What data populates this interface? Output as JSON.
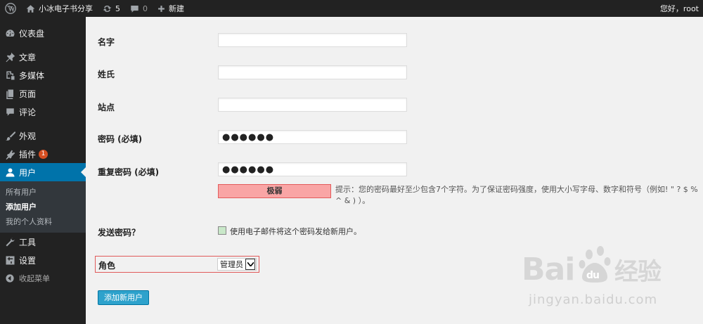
{
  "adminbar": {
    "site_name": "小冰电子书分享",
    "updates_count": "5",
    "comments_count": "0",
    "new_label": "新建",
    "greeting": "您好，root"
  },
  "sidebar": {
    "items": [
      {
        "label": "仪表盘",
        "icon": "dashboard-icon"
      },
      {
        "label": "文章",
        "icon": "pin-icon"
      },
      {
        "label": "多媒体",
        "icon": "media-icon"
      },
      {
        "label": "页面",
        "icon": "page-icon"
      },
      {
        "label": "评论",
        "icon": "comment-icon"
      },
      {
        "label": "外观",
        "icon": "brush-icon"
      },
      {
        "label": "插件",
        "icon": "plugin-icon",
        "badge": "1"
      },
      {
        "label": "用户",
        "icon": "user-icon"
      },
      {
        "label": "工具",
        "icon": "wrench-icon"
      },
      {
        "label": "设置",
        "icon": "settings-icon"
      },
      {
        "label": "收起菜单",
        "icon": "collapse-icon"
      }
    ],
    "submenu": [
      "所有用户",
      "添加用户",
      "我的个人资料"
    ]
  },
  "form": {
    "first_name_label": "名字",
    "last_name_label": "姓氏",
    "website_label": "站点",
    "password_label": "密码 (必填)",
    "password_value": "●●●●●●",
    "repeat_password_label": "重复密码 (必填)",
    "repeat_password_value": "●●●●●●",
    "strength": "极弱",
    "hint": "提示：您的密码最好至少包含7个字符。为了保证密码强度，使用大小写字母、数字和符号（例如! \" ? $ % ^ & ) ）。",
    "send_password_label": "发送密码？",
    "send_password_checkbox": "使用电子邮件将这个密码发给新用户。",
    "role_label": "角色",
    "role_value": "管理员",
    "submit_label": "添加新用户"
  },
  "watermark": {
    "logo": "Bai du 经验",
    "url": "jingyan.baidu.com"
  },
  "colors": {
    "adminbar_bg": "#222222",
    "accent": "#0073aa",
    "button": "#2ea2cc",
    "strength_bg": "#f9a5a5"
  }
}
